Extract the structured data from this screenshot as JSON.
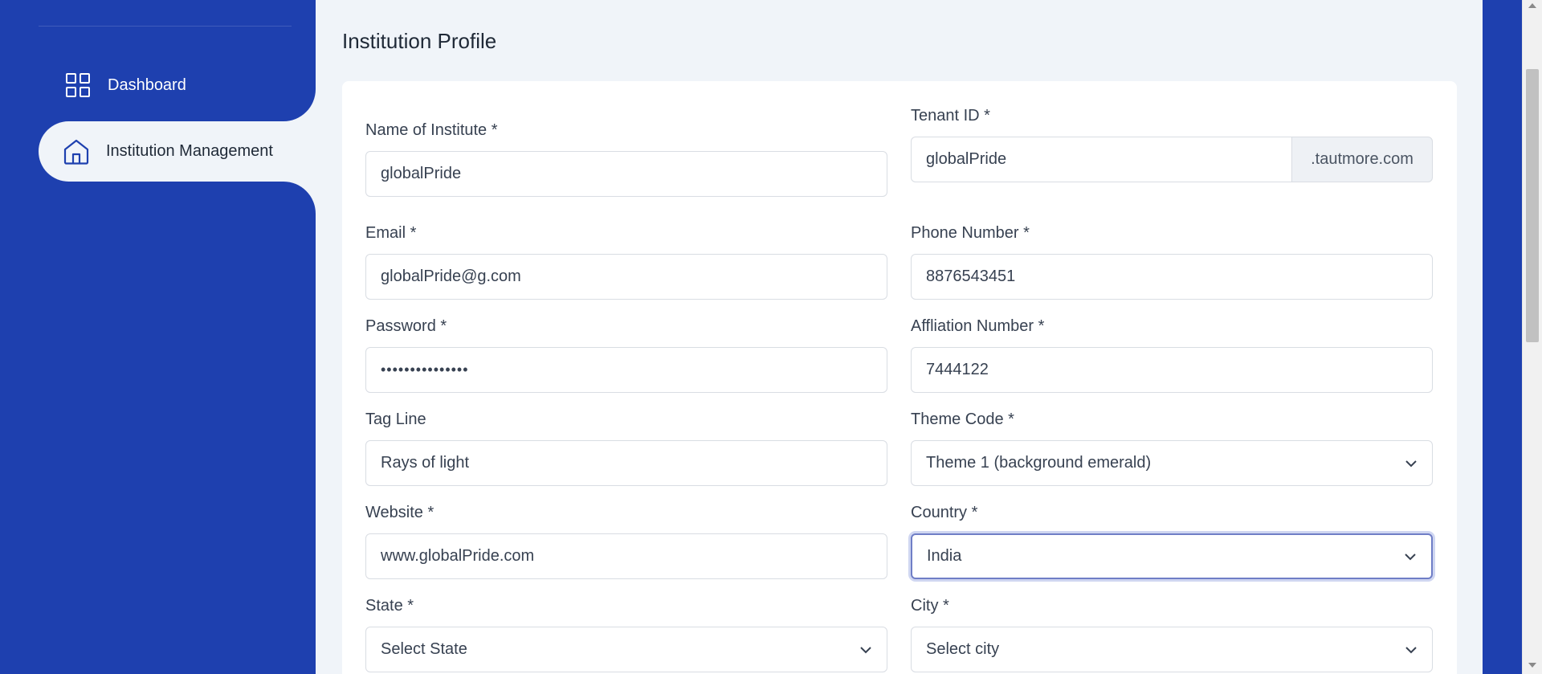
{
  "sidebar": {
    "items": [
      {
        "label": "Dashboard",
        "icon": "grid-icon",
        "active": false
      },
      {
        "label": "Institution Management",
        "icon": "home-icon",
        "active": true
      }
    ]
  },
  "page": {
    "title": "Institution Profile"
  },
  "form": {
    "name": {
      "label": "Name of Institute *",
      "value": "globalPride"
    },
    "tenant": {
      "label": "Tenant ID *",
      "value": "globalPride",
      "suffix": ".tautmore.com"
    },
    "email": {
      "label": "Email *",
      "value": "globalPride@g.com"
    },
    "phone": {
      "label": "Phone Number *",
      "value": "8876543451"
    },
    "password": {
      "label": "Password *",
      "value": "•••••••••••••••"
    },
    "affiliation": {
      "label": "Affliation Number *",
      "value": "7444122"
    },
    "tagline": {
      "label": "Tag Line",
      "value": "Rays of light"
    },
    "theme": {
      "label": "Theme Code *",
      "value": "Theme 1 (background emerald)"
    },
    "website": {
      "label": "Website *",
      "value": "www.globalPride.com"
    },
    "country": {
      "label": "Country *",
      "value": "India"
    },
    "state": {
      "label": "State *",
      "value": "Select State"
    },
    "city": {
      "label": "City *",
      "value": "Select city"
    }
  },
  "colors": {
    "sidebar": "#1e40af",
    "background": "#f0f4f9",
    "accent": "#6f7ec6"
  }
}
